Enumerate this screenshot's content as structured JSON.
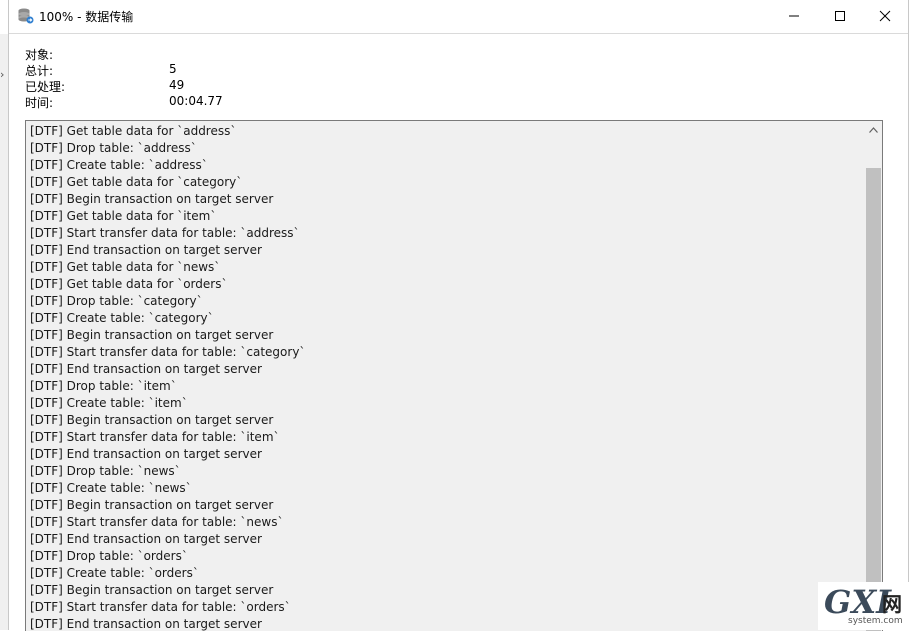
{
  "window": {
    "title": "100% - 数据传输",
    "icon": "database-transfer-icon"
  },
  "stats": [
    {
      "label": "对象:",
      "value": ""
    },
    {
      "label": "总计:",
      "value": "5"
    },
    {
      "label": "已处理:",
      "value": "49"
    },
    {
      "label": "时间:",
      "value": "00:04.77"
    }
  ],
  "log": [
    "[DTF] Get table data for `address`",
    "[DTF] Drop table: `address`",
    "[DTF] Create table: `address`",
    "[DTF] Get table data for `category`",
    "[DTF] Begin transaction on target server",
    "[DTF] Get table data for `item`",
    "[DTF] Start transfer data for table: `address`",
    "[DTF] End transaction on target server",
    "[DTF] Get table data for `news`",
    "[DTF] Get table data for `orders`",
    "[DTF] Drop table: `category`",
    "[DTF] Create table: `category`",
    "[DTF] Begin transaction on target server",
    "[DTF] Start transfer data for table: `category`",
    "[DTF] End transaction on target server",
    "[DTF] Drop table: `item`",
    "[DTF] Create table: `item`",
    "[DTF] Begin transaction on target server",
    "[DTF] Start transfer data for table: `item`",
    "[DTF] End transaction on target server",
    "[DTF] Drop table: `news`",
    "[DTF] Create table: `news`",
    "[DTF] Begin transaction on target server",
    "[DTF] Start transfer data for table: `news`",
    "[DTF] End transaction on target server",
    "[DTF] Drop table: `orders`",
    "[DTF] Create table: `orders`",
    "[DTF] Begin transaction on target server",
    "[DTF] Start transfer data for table: `orders`",
    "[DTF] End transaction on target server"
  ],
  "watermark": {
    "logo": "GXI",
    "net": "网",
    "domain": "system.com"
  },
  "colors": {
    "log_background": "#f0f0f0",
    "scroll_thumb": "#c0c0c0",
    "border": "#7a7a7a"
  }
}
